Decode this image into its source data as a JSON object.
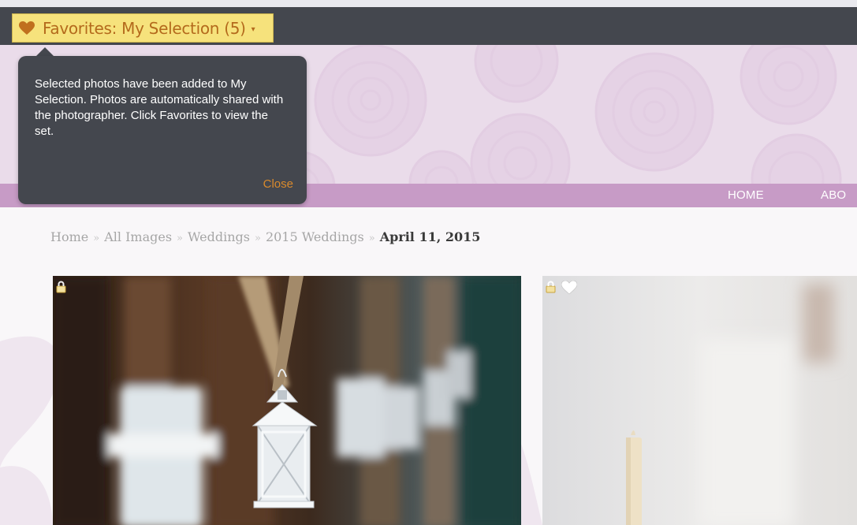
{
  "favorites": {
    "label": "Favorites: My Selection (5)",
    "caret": "▾",
    "icon": "heart-icon"
  },
  "tooltip": {
    "message": "Selected photos have been added to My Selection. Photos are automatically shared with the photographer. Click Favorites to view the set.",
    "close_label": "Close"
  },
  "nav": {
    "items": [
      {
        "label": "HOME"
      },
      {
        "label": "ABO"
      }
    ]
  },
  "breadcrumb": {
    "items": [
      "Home",
      "All Images",
      "Weddings",
      "2015 Weddings"
    ],
    "separator": "»",
    "current": "April 11, 2015"
  },
  "gallery": {
    "photos": [
      {
        "name": "lanterns-photo",
        "icons": [
          "lock-icon"
        ]
      },
      {
        "name": "candle-photo",
        "icons": [
          "lock-icon",
          "heart-icon"
        ]
      }
    ]
  },
  "colors": {
    "topbar": "#44474e",
    "favorites_bg": "#f6e27c",
    "favorites_text": "#b46a1c",
    "header_band": "#eadcea",
    "navbar": "#c79bc6",
    "tooltip_bg": "#44474e",
    "close_link": "#d98a2c"
  }
}
